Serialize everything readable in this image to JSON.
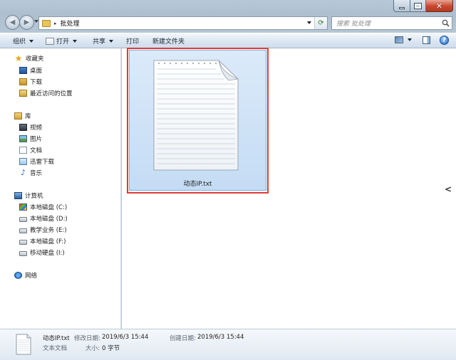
{
  "window": {
    "caption": {
      "minimize_icon": "minimize-icon",
      "maximize_icon": "maximize-icon",
      "close_glyph": "✕"
    }
  },
  "navigation": {
    "back_glyph": "◀",
    "forward_glyph": "▶"
  },
  "address_bar": {
    "separator": "▸",
    "path": "批处理",
    "refresh_glyph": "⟳"
  },
  "search": {
    "placeholder": "搜索 批处理"
  },
  "command_bar": {
    "organize": "组织",
    "open": "打开",
    "share": "共享",
    "print": "打印",
    "new_folder": "新建文件夹",
    "help_glyph": "?"
  },
  "nav_pane": {
    "favorites": {
      "label": "收藏夹",
      "items": [
        "桌面",
        "下载",
        "最近访问的位置"
      ]
    },
    "libraries": {
      "label": "库",
      "items": [
        "视频",
        "图片",
        "文档",
        "迅雷下载",
        "音乐"
      ]
    },
    "computer": {
      "label": "计算机",
      "items": [
        "本地磁盘 (C:)",
        "本地磁盘 (D:)",
        "教学业务 (E:)",
        "本地磁盘 (F:)",
        "移动硬盘 (I:)"
      ]
    },
    "network": {
      "label": "网络"
    }
  },
  "content": {
    "files": [
      {
        "name": "动态IP.txt",
        "selected": true
      }
    ],
    "scroll_glyph": "<"
  },
  "details": {
    "file_name": "动态IP.txt",
    "modified_label": "修改日期:",
    "modified_value": "2019/6/3 15:44",
    "created_label": "创建日期:",
    "created_value": "2019/6/3 15:44",
    "type": "文本文档",
    "size_label": "大小:",
    "size_value": "0 字节"
  },
  "colors": {
    "selection_fill": "#cfe3f8",
    "selection_border": "#84acdd",
    "highlight_box": "#e03a3a"
  }
}
